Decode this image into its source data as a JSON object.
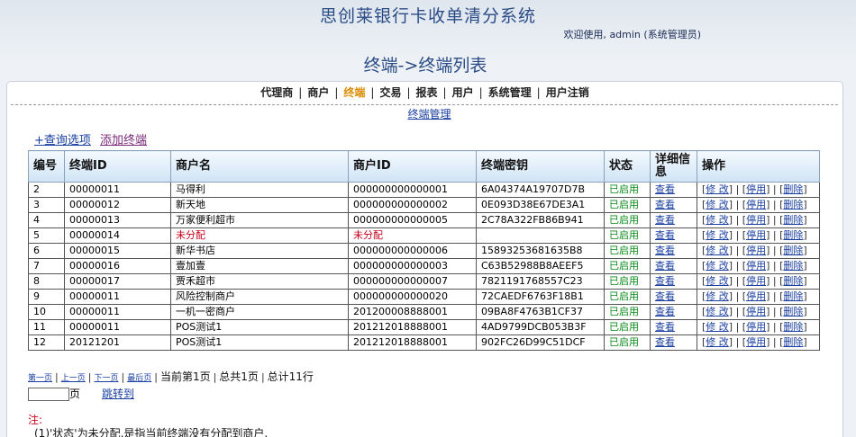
{
  "header": {
    "system_title": "思创莱银行卡收单清分系统",
    "welcome_prefix": "欢迎使用,",
    "username": "admin",
    "role": "(系统管理员)",
    "page_title": "终端->终端列表"
  },
  "nav": {
    "items": [
      "代理商",
      "商户",
      "终端",
      "交易",
      "报表",
      "用户",
      "系统管理",
      "用户注销"
    ],
    "active": "终端",
    "sub_item": "终端管理"
  },
  "actions": {
    "query_options": "+查询选项",
    "add_terminal": "添加终端"
  },
  "table": {
    "columns": [
      "编号",
      "终端ID",
      "商户名",
      "商户ID",
      "终端密钥",
      "状态",
      "详细信息",
      "操作"
    ],
    "rows": [
      {
        "no": "2",
        "terminal_id": "00000011",
        "merchant_name": "马得利",
        "merchant_id": "000000000000001",
        "key": "6A04374A19707D7B",
        "status": "已启用",
        "detail": "查看"
      },
      {
        "no": "3",
        "terminal_id": "00000012",
        "merchant_name": "新天地",
        "merchant_id": "000000000000002",
        "key": "0E093D38E67DE3A1",
        "status": "已启用",
        "detail": "查看"
      },
      {
        "no": "4",
        "terminal_id": "00000013",
        "merchant_name": "万家便利超市",
        "merchant_id": "000000000000005",
        "key": "2C78A322FB86B941",
        "status": "已启用",
        "detail": "查看"
      },
      {
        "no": "5",
        "terminal_id": "00000014",
        "merchant_name": "未分配",
        "merchant_id": "未分配",
        "key": "",
        "status": "已启用",
        "detail": "查看",
        "unassigned": true
      },
      {
        "no": "6",
        "terminal_id": "00000015",
        "merchant_name": "新华书店",
        "merchant_id": "000000000000006",
        "key": "15893253681635B8",
        "status": "已启用",
        "detail": "查看"
      },
      {
        "no": "7",
        "terminal_id": "00000016",
        "merchant_name": "壹加壹",
        "merchant_id": "000000000000003",
        "key": "C63B52988B8AEEF5",
        "status": "已启用",
        "detail": "查看"
      },
      {
        "no": "8",
        "terminal_id": "00000017",
        "merchant_name": "贾禾超市",
        "merchant_id": "000000000000007",
        "key": "7821191768557C23",
        "status": "已启用",
        "detail": "查看"
      },
      {
        "no": "9",
        "terminal_id": "00000011",
        "merchant_name": "风险控制商户",
        "merchant_id": "000000000000020",
        "key": "72CAEDF6763F18B1",
        "status": "已启用",
        "detail": "查看"
      },
      {
        "no": "10",
        "terminal_id": "00000011",
        "merchant_name": "一机一密商户",
        "merchant_id": "201200008888001",
        "key": "09BA8F4763B1CF37",
        "status": "已启用",
        "detail": "查看"
      },
      {
        "no": "11",
        "terminal_id": "00000011",
        "merchant_name": "POS测试1",
        "merchant_id": "201212018888001",
        "key": "4AD9799DCB053B3F",
        "status": "已启用",
        "detail": "查看"
      },
      {
        "no": "12",
        "terminal_id": "20121201",
        "merchant_name": "POS测试1",
        "merchant_id": "201212018888001",
        "key": "902FC26D99C51DCF",
        "status": "已启用",
        "detail": "查看"
      }
    ],
    "ops": {
      "edit": "修 改",
      "disable": "停用",
      "delete": "删除"
    }
  },
  "pager": {
    "first": "第一页",
    "prev": "上一页",
    "next": "下一页",
    "last": "最后页",
    "current": "当前第1页",
    "total_pages": "总共1页",
    "total_rows": "总计11行",
    "page_input_value": "",
    "page_unit": "页",
    "jump": "跳转到"
  },
  "notes": {
    "title": "注:",
    "line1": "(1)'状态'为未分配,是指当前终端没有分配到商户."
  },
  "colors": {
    "title_blue": "#2a4b86",
    "active_nav": "#d98c00",
    "status_green": "#0a8a1a",
    "alert_red": "#c4001a",
    "link_blue": "#1a3fa0"
  }
}
